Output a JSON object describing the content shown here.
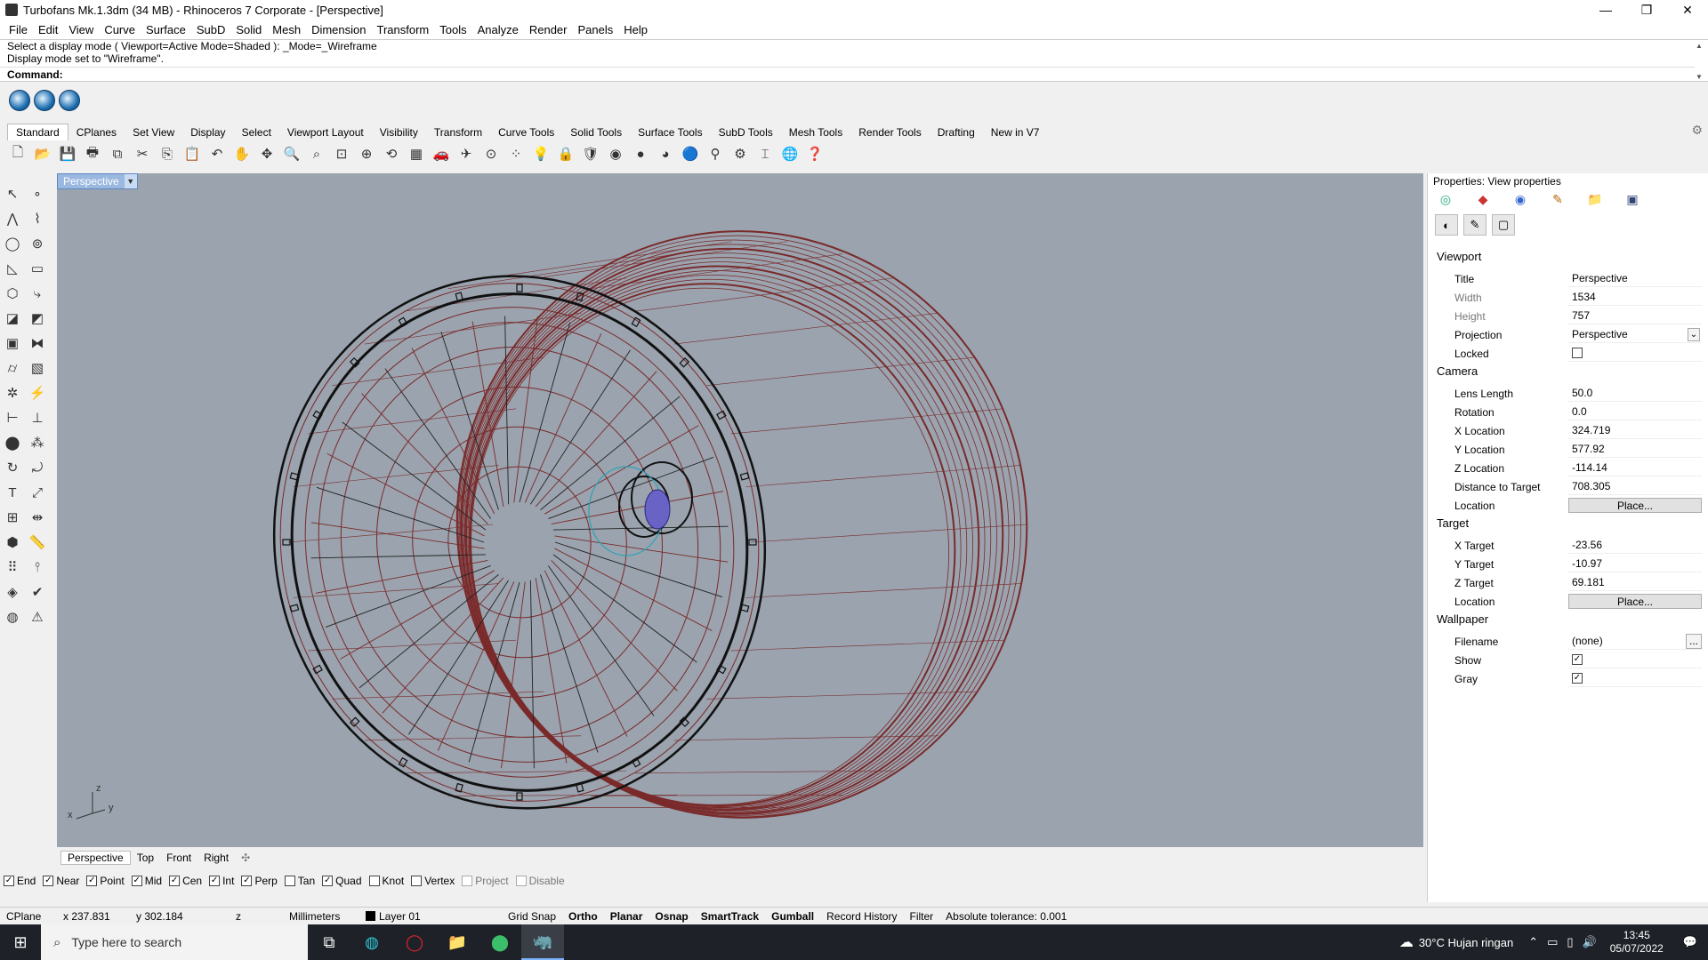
{
  "window": {
    "title": "Turbofans Mk.1.3dm (34 MB) - Rhinoceros 7 Corporate - [Perspective]",
    "controls": [
      "—",
      "❐",
      "✕"
    ]
  },
  "menu": [
    "File",
    "Edit",
    "View",
    "Curve",
    "Surface",
    "SubD",
    "Solid",
    "Mesh",
    "Dimension",
    "Transform",
    "Tools",
    "Analyze",
    "Render",
    "Panels",
    "Help"
  ],
  "command": {
    "history": [
      "Select a display mode ( Viewport=Active  Mode=Shaded ): _Mode=_Wireframe",
      "Display mode set to \"Wireframe\"."
    ],
    "prompt": "Command:"
  },
  "toolbar_tabs": [
    "Standard",
    "CPlanes",
    "Set View",
    "Display",
    "Select",
    "Viewport Layout",
    "Visibility",
    "Transform",
    "Curve Tools",
    "Solid Tools",
    "Surface Tools",
    "SubD Tools",
    "Mesh Tools",
    "Render Tools",
    "Drafting",
    "New in V7"
  ],
  "viewport": {
    "name": "Perspective",
    "axis_z": "z",
    "axis_x": "x",
    "axis_y": "y",
    "wire_color": "#7a2a2a",
    "bg_color": "#9aa3ae"
  },
  "view_tabs": [
    "Perspective",
    "Top",
    "Front",
    "Right"
  ],
  "osnaps": [
    {
      "label": "End",
      "checked": true,
      "enabled": true
    },
    {
      "label": "Near",
      "checked": true,
      "enabled": true
    },
    {
      "label": "Point",
      "checked": true,
      "enabled": true
    },
    {
      "label": "Mid",
      "checked": true,
      "enabled": true
    },
    {
      "label": "Cen",
      "checked": true,
      "enabled": true
    },
    {
      "label": "Int",
      "checked": true,
      "enabled": true
    },
    {
      "label": "Perp",
      "checked": true,
      "enabled": true
    },
    {
      "label": "Tan",
      "checked": false,
      "enabled": true
    },
    {
      "label": "Quad",
      "checked": true,
      "enabled": true
    },
    {
      "label": "Knot",
      "checked": false,
      "enabled": true
    },
    {
      "label": "Vertex",
      "checked": false,
      "enabled": true
    },
    {
      "label": "Project",
      "checked": false,
      "enabled": false
    },
    {
      "label": "Disable",
      "checked": false,
      "enabled": false
    }
  ],
  "status": {
    "cplane": "CPlane",
    "x": "x 237.831",
    "y": "y 302.184",
    "z": "z",
    "units": "Millimeters",
    "layer": "Layer 01",
    "grid_snap": "Grid Snap",
    "ortho": "Ortho",
    "planar": "Planar",
    "osnap": "Osnap",
    "smarttrack": "SmartTrack",
    "gumball": "Gumball",
    "record_history": "Record History",
    "filter": "Filter",
    "tolerance": "Absolute tolerance: 0.001"
  },
  "properties": {
    "title": "Properties: View properties",
    "viewport_section": "Viewport",
    "viewport_rows": [
      {
        "label": "Title",
        "value": "Perspective"
      },
      {
        "label": "Width",
        "value": "1534"
      },
      {
        "label": "Height",
        "value": "757"
      },
      {
        "label": "Projection",
        "value": "Perspective"
      },
      {
        "label": "Locked",
        "value": ""
      }
    ],
    "camera_section": "Camera",
    "camera_rows": [
      {
        "label": "Lens Length",
        "value": "50.0"
      },
      {
        "label": "Rotation",
        "value": "0.0"
      },
      {
        "label": "X Location",
        "value": "324.719"
      },
      {
        "label": "Y Location",
        "value": "577.92"
      },
      {
        "label": "Z Location",
        "value": "-114.14"
      },
      {
        "label": "Distance to Target",
        "value": "708.305"
      },
      {
        "label": "Location",
        "value": "Place..."
      }
    ],
    "target_section": "Target",
    "target_rows": [
      {
        "label": "X Target",
        "value": "-23.56"
      },
      {
        "label": "Y Target",
        "value": "-10.97"
      },
      {
        "label": "Z Target",
        "value": "69.181"
      },
      {
        "label": "Location",
        "value": "Place..."
      }
    ],
    "wallpaper_section": "Wallpaper",
    "wallpaper_rows": [
      {
        "label": "Filename",
        "value": "(none)"
      },
      {
        "label": "Show",
        "value": ""
      },
      {
        "label": "Gray",
        "value": ""
      }
    ],
    "browse_label": "..."
  },
  "taskbar": {
    "search_placeholder": "Type here to search",
    "weather": "30°C  Hujan ringan",
    "time": "13:45",
    "date": "05/07/2022"
  }
}
